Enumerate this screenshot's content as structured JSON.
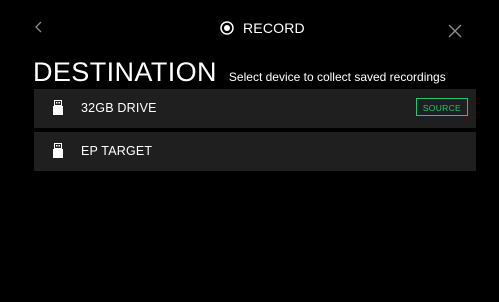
{
  "header": {
    "back_icon": "chevron-left-icon",
    "record_icon": "radio-selected-icon",
    "record_label": "RECORD",
    "close_icon": "close-icon"
  },
  "page": {
    "title": "DESTINATION",
    "subtitle": "Select device to collect saved recordings"
  },
  "devices": [
    {
      "name": "32GB DRIVE",
      "icon": "usb-drive-icon",
      "badge": "SOURCE"
    },
    {
      "name": "EP TARGET",
      "icon": "usb-drive-icon",
      "badge": ""
    }
  ],
  "colors": {
    "background": "#000000",
    "row_background": "#1f1f1f",
    "accent_green": "#22c76a",
    "icon_gray": "#8a8a8a"
  }
}
